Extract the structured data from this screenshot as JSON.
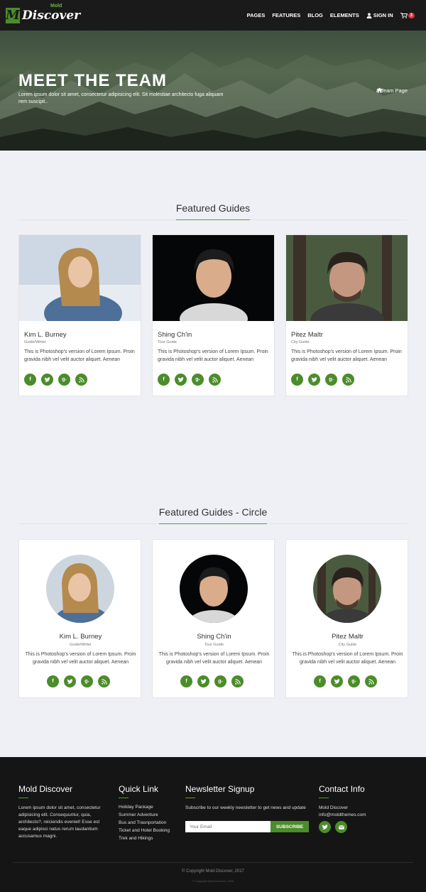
{
  "nav": {
    "logo_badge": "M",
    "logo_small": "Mold",
    "logo_text": "Discover",
    "items": [
      {
        "label": "PAGES"
      },
      {
        "label": "FEATURES"
      },
      {
        "label": "BLOG"
      },
      {
        "label": "ELEMENTS"
      },
      {
        "label": "SIGN IN"
      }
    ],
    "cart_count": "3"
  },
  "hero": {
    "title": "MEET THE TEAM",
    "subtitle": "Lorem ipsum dolor sit amet, consectetur adipisicing elit. Sit molestiae architecto fuga aliquam rem suscipit..",
    "breadcrumb_current": "Team Page"
  },
  "featured": {
    "title": "Featured Guides",
    "guides": [
      {
        "name": "Kim L. Burney",
        "role": "Guide/Writer",
        "desc": "This is Photoshop's version of Lorem Ipsum. Proin gravida nibh vel velit auctor aliquet. Aenean"
      },
      {
        "name": "Shing Ch'in",
        "role": "Tour Guide",
        "desc": "This is Photoshop's version of Lorem Ipsum. Proin gravida nibh vel velit auctor aliquet. Aenean"
      },
      {
        "name": "Pitez Maltr",
        "role": "City Guide",
        "desc": "This is Photoshop's version of Lorem Ipsum. Proin gravida nibh vel velit auctor aliquet. Aenean"
      }
    ]
  },
  "circle": {
    "title": "Featured Guides - Circle",
    "guides": [
      {
        "name": "Kim L. Burney",
        "role": "Guide/Writer",
        "desc": "This is Photoshop's version of Lorem Ipsum. Proin gravida nibh vel velit auctor aliquet. Aenean"
      },
      {
        "name": "Shing Ch'in",
        "role": "Tour Guide",
        "desc": "This is Photoshop's version of Lorem Ipsum. Proin gravida nibh vel velit auctor aliquet. Aenean"
      },
      {
        "name": "Pitez Maltr",
        "role": "City Guide",
        "desc": "This is Photoshop's version of Lorem Ipsum. Proin gravida nibh vel velit auctor aliquet. Aenean"
      }
    ]
  },
  "social_icons": [
    "facebook-icon",
    "twitter-icon",
    "google-plus-icon",
    "rss-icon"
  ],
  "footer": {
    "about_title": "Mold Discover",
    "about_text": "Lorem ipsum dolor sit amet, consectetur adipisicing elit. Consequuntur, quia, architecto?, reiciendis eveniet! Esse est eaque adipisci natus rerum laudantium accusamus magni.",
    "quick_title": "Quick Link",
    "quick_links": [
      "Holiday Package",
      "Summer Adventure",
      "Bus and Trasnportation",
      "Ticket and Hotel Booking",
      "Trek and Hikings"
    ],
    "newsletter_title": "Newsletter Signup",
    "newsletter_text": "Subscribe to our weekly newsletter to get news and update",
    "email_placeholder": "Your Email",
    "subscribe_label": "SUBSCRIBE",
    "contact_title": "Contact Info",
    "contact_name": "Mold Discover",
    "contact_email": "info@moldthemes.com",
    "copyright": "Copyright Mold Discover, 2017",
    "copyright_small": "Copyright Mold Discover, 2016"
  },
  "colors": {
    "accent": "#4c8c2b",
    "nav_bg": "#1a1a1a",
    "page_bg": "#eff0f6",
    "footer_bg": "#151515",
    "cart_badge": "#d9313a"
  }
}
